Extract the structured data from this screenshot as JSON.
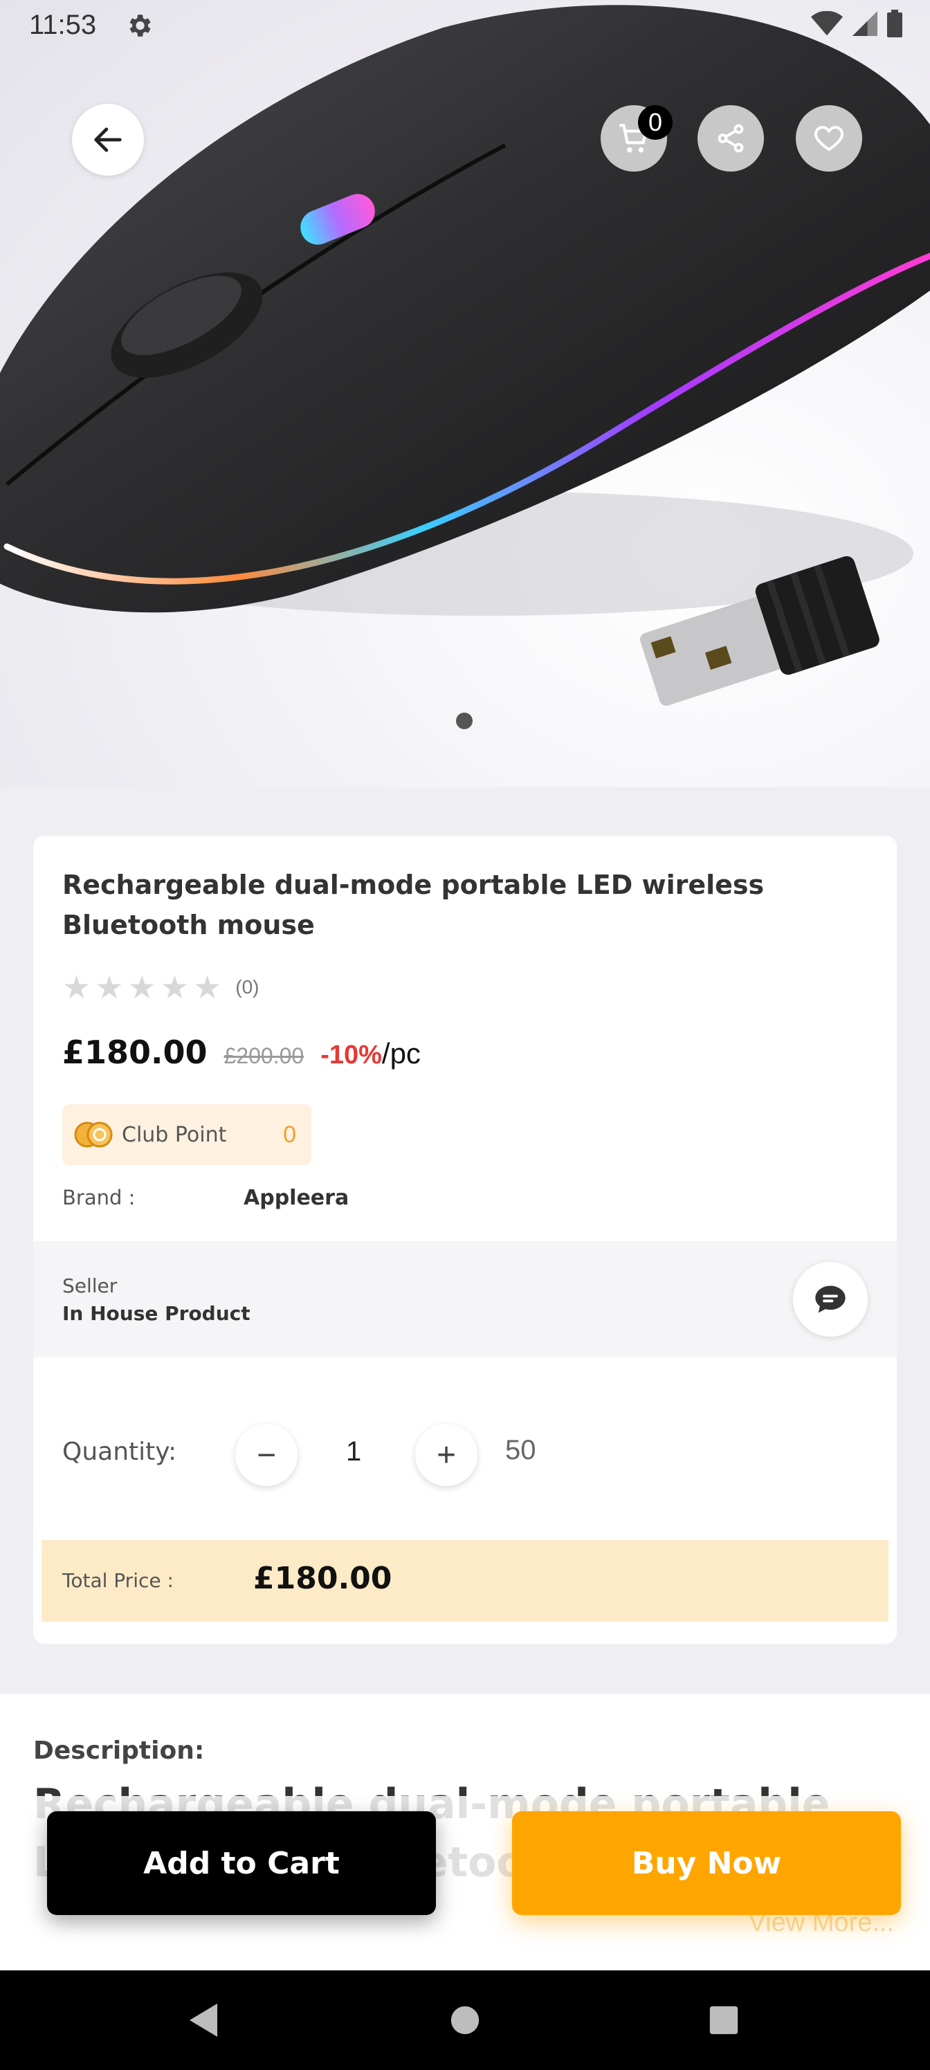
{
  "status_bar": {
    "time": "11:53",
    "icons": [
      "gear-icon",
      "wifi-icon",
      "signal-icon",
      "battery-icon"
    ]
  },
  "header": {
    "cart_count": "0",
    "icons": [
      "back-arrow-icon",
      "cart-icon",
      "share-icon",
      "heart-icon"
    ]
  },
  "product": {
    "title": "Rechargeable dual-mode portable LED wireless Bluetooth mouse",
    "rating_stars": 0,
    "review_count": "(0)",
    "price": "£180.00",
    "old_price": "£200.00",
    "discount": "-10%",
    "unit": "/pc",
    "club_point_label": "Club Point",
    "club_point_value": "0",
    "brand_label": "Brand :",
    "brand_value": "Appleera"
  },
  "seller": {
    "label": "Seller",
    "name": "In House Product"
  },
  "quantity": {
    "label": "Quantity:",
    "value": "1",
    "stock": "50",
    "minus": "−",
    "plus": "+"
  },
  "total": {
    "label": "Total Price  :",
    "value": "£180.00"
  },
  "description": {
    "title": "Description:",
    "text": "Rechargeable dual-mode portable LED wireless Bluetooth mouse",
    "view_more": "View More..."
  },
  "actions": {
    "add_to_cart": "Add to Cart",
    "buy_now": "Buy Now"
  },
  "colors": {
    "accent": "#ffa500",
    "discount": "#e53935",
    "club_point": "#f0a22a",
    "total_bg": "#fdebc8"
  }
}
